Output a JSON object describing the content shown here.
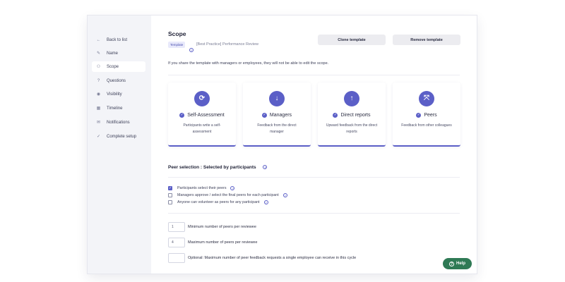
{
  "sidebar": {
    "items": [
      {
        "icon": "arrow-left-icon",
        "glyph": "←",
        "label": "Back to list"
      },
      {
        "icon": "pencil-icon",
        "glyph": "✎",
        "label": "Name"
      },
      {
        "icon": "scope-icon",
        "glyph": "⚇",
        "label": "Scope"
      },
      {
        "icon": "question-icon",
        "glyph": "?",
        "label": "Questions"
      },
      {
        "icon": "eye-icon",
        "glyph": "◉",
        "label": "Visibility"
      },
      {
        "icon": "calendar-icon",
        "glyph": "▦",
        "label": "Timeline"
      },
      {
        "icon": "mail-icon",
        "glyph": "✉",
        "label": "Notifications"
      },
      {
        "icon": "check-icon",
        "glyph": "✓",
        "label": "Complete setup"
      }
    ],
    "active": "Scope"
  },
  "header": {
    "title": "Scope",
    "badge": "Template",
    "subtitle": "[Best Practice] Performance Review",
    "clone_label": "Clone template",
    "remove_label": "Remove template"
  },
  "notice": "If you share the template with managers or employees, they will not be able to edit the scope.",
  "cards": [
    {
      "icon": "refresh-icon",
      "glyph": "⟳",
      "title": "Self-Assessment",
      "desc": "Participants write a self-assessment"
    },
    {
      "icon": "arrow-down-icon",
      "glyph": "↓",
      "title": "Managers",
      "desc": "Feedback from the direct manager"
    },
    {
      "icon": "arrow-up-icon",
      "glyph": "↑",
      "title": "Direct reports",
      "desc": "Upward feedback from the direct reports"
    },
    {
      "icon": "arrows-cross-icon",
      "glyph": "⤧",
      "title": "Peers",
      "desc": "Feedback from other colleagues"
    }
  ],
  "peer_selection": {
    "title": "Peer selection : Selected by participants",
    "options": [
      {
        "label": "Participants select their peers",
        "checked": true
      },
      {
        "label": "Managers approve / select the final peers for each participant",
        "checked": false
      },
      {
        "label": "Anyone can volunteer as peers for any participant",
        "checked": false
      }
    ]
  },
  "limits": [
    {
      "value": "1",
      "label": "Minimum number of peers per reviewee"
    },
    {
      "value": "4",
      "label": "Maximum number of peers per reviewee"
    },
    {
      "value": "",
      "label": "Optional: Maximum number of peer feedback requests a single employee can receive in this cycle"
    }
  ],
  "help_label": "Help",
  "colors": {
    "accent": "#5b5fc7",
    "help": "#2f7a55"
  }
}
